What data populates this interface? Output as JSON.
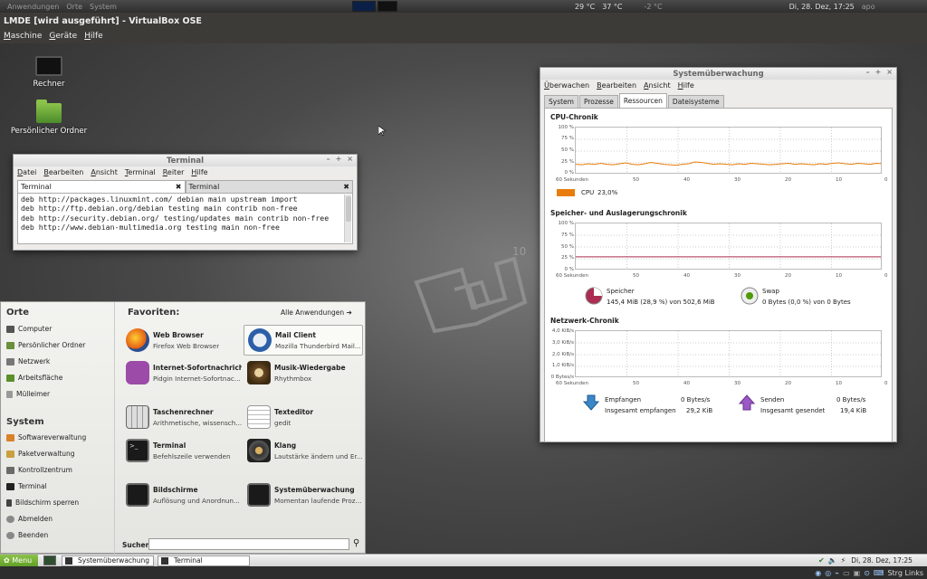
{
  "host_panel": {
    "items": [
      "Anwendungen",
      "Orte",
      "System"
    ],
    "temps": [
      "29 °C",
      "37 °C",
      "-2 °C"
    ],
    "clock": "Di, 28. Dez, 17:25",
    "user": "apo"
  },
  "vbox": {
    "title": "LMDE [wird ausgeführt] - VirtualBox OSE",
    "menu": [
      "Maschine",
      "Geräte",
      "Hilfe"
    ]
  },
  "desktop": {
    "icons": [
      "Rechner",
      "Persönlicher Ordner"
    ]
  },
  "terminal": {
    "title": "Terminal",
    "menu": [
      "Datei",
      "Bearbeiten",
      "Ansicht",
      "Terminal",
      "Reiter",
      "Hilfe"
    ],
    "tabs": [
      "Terminal",
      "Terminal"
    ],
    "lines": [
      "deb http://packages.linuxmint.com/ debian main upstream import",
      "deb http://ftp.debian.org/debian testing main contrib non-free",
      "deb http://security.debian.org/ testing/updates main contrib non-free",
      "deb http://www.debian-multimedia.org testing main non-free"
    ]
  },
  "sysmon": {
    "title": "Systemüberwachung",
    "menu": [
      "Überwachen",
      "Bearbeiten",
      "Ansicht",
      "Hilfe"
    ],
    "tabs": [
      "System",
      "Prozesse",
      "Ressourcen",
      "Dateisysteme"
    ],
    "cpu_title": "CPU-Chronik",
    "mem_title": "Speicher- und Auslagerungschronik",
    "net_title": "Netzwerk-Chronik",
    "pct_ticks": [
      "100 %",
      "75 %",
      "50 %",
      "25 %",
      "0 %"
    ],
    "net_ticks": [
      "4,0 KiB/s",
      "3,0 KiB/s",
      "2,0 KiB/s",
      "1,0 KiB/s",
      "0 Bytes/s"
    ],
    "x_ticks": [
      "60 Sekunden",
      "50",
      "40",
      "30",
      "20",
      "10",
      "0"
    ],
    "cpu_label": "CPU",
    "cpu_value": "23,0%",
    "cpu_color": "#e87d0d",
    "mem_label": "Speicher",
    "mem_value": "145,4 MiB (28,9 %) von 502,6 MiB",
    "mem_color": "#ad2c52",
    "swap_label": "Swap",
    "swap_value": "0 Bytes (0,0 %) von 0 Bytes",
    "swap_color": "#4e9a06",
    "recv_label": "Empfangen",
    "recv_rate": "0 Bytes/s",
    "recv_total_label": "Insgesamt empfangen",
    "recv_total": "29,2 KiB",
    "send_label": "Senden",
    "send_rate": "0 Bytes/s",
    "send_total_label": "Insgesamt gesendet",
    "send_total": "19,4 KiB",
    "cpu_history": [
      22,
      21,
      23,
      22,
      24,
      22,
      21,
      23,
      25,
      22,
      21,
      23,
      26,
      24,
      22,
      21,
      20,
      22,
      23,
      27,
      26,
      24,
      22,
      23,
      22,
      21,
      23,
      22,
      24,
      23,
      22,
      21,
      22,
      23,
      24,
      22,
      23,
      22,
      21,
      23,
      22,
      24,
      25,
      23,
      22,
      24,
      23,
      22,
      24,
      23
    ],
    "mem_history_pct": 29,
    "swap_history_pct": 0
  },
  "menu": {
    "places_title": "Orte",
    "places": [
      "Computer",
      "Persönlicher Ordner",
      "Netzwerk",
      "Arbeitsfläche",
      "Mülleimer"
    ],
    "system_title": "System",
    "system": [
      "Softwareverwaltung",
      "Paketverwaltung",
      "Kontrollzentrum",
      "Terminal",
      "Bildschirm sperren",
      "Abmelden",
      "Beenden"
    ],
    "favorites_title": "Favoriten:",
    "all_apps": "Alle Anwendungen",
    "search_label": "Suchen",
    "favorites": [
      {
        "title": "Web Browser",
        "sub": "Firefox Web Browser"
      },
      {
        "title": "Mail Client",
        "sub": "Mozilla Thunderbird Mail..."
      },
      {
        "title": "Internet-Sofortnachricht...",
        "sub": "Pidgin Internet-Sofortnac..."
      },
      {
        "title": "Musik-Wiedergabe",
        "sub": "Rhythmbox"
      },
      {
        "title": "Taschenrechner",
        "sub": "Arithmetische, wissensch..."
      },
      {
        "title": "Texteditor",
        "sub": "gedit"
      },
      {
        "title": "Terminal",
        "sub": "Befehlszeile verwenden"
      },
      {
        "title": "Klang",
        "sub": "Lautstärke ändern und Er..."
      },
      {
        "title": "Bildschirme",
        "sub": "Auflösung und Anordnun..."
      },
      {
        "title": "Systemüberwachung",
        "sub": "Momentan laufende Proz..."
      }
    ]
  },
  "bottom_panel": {
    "menu_label": "Menu",
    "tasks": [
      "Systemüberwachung",
      "Terminal"
    ],
    "clock": "Di, 28. Dez, 17:25"
  },
  "host_bottom": {
    "label": "Strg Links"
  }
}
